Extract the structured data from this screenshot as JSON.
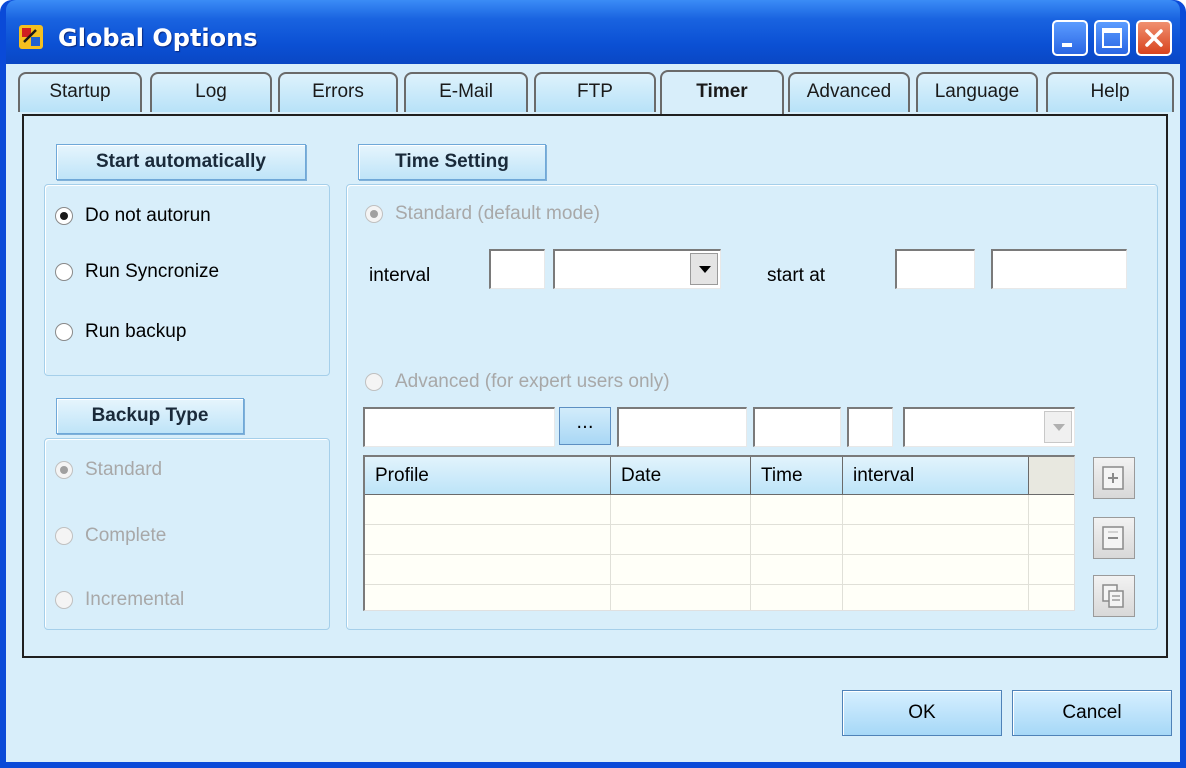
{
  "window": {
    "title": "Global Options"
  },
  "tabs": [
    {
      "label": "Startup"
    },
    {
      "label": "Log"
    },
    {
      "label": "Errors"
    },
    {
      "label": "E-Mail"
    },
    {
      "label": "FTP"
    },
    {
      "label": "Timer",
      "active": true
    },
    {
      "label": "Advanced"
    },
    {
      "label": "Language"
    },
    {
      "label": "Help"
    }
  ],
  "start_auto": {
    "heading": "Start automatically",
    "options": [
      {
        "label": "Do not autorun",
        "selected": true
      },
      {
        "label": "Run Syncronize",
        "selected": false
      },
      {
        "label": "Run backup",
        "selected": false
      }
    ]
  },
  "backup_type": {
    "heading": "Backup Type",
    "options": [
      {
        "label": "Standard",
        "selected": true,
        "disabled": true
      },
      {
        "label": "Complete",
        "selected": false,
        "disabled": true
      },
      {
        "label": "Incremental",
        "selected": false,
        "disabled": true
      }
    ]
  },
  "time_setting": {
    "heading": "Time Setting",
    "standard_label": "Standard (default mode)",
    "interval_label": "interval",
    "interval_value": "",
    "interval_unit": "",
    "start_at_label": "start at",
    "start_date": "",
    "start_time": "",
    "advanced_label": "Advanced (for expert users only)",
    "profile_value": "",
    "browse_label": "...",
    "date_value": "",
    "time_value": "",
    "interval_adv_value": "",
    "interval_adv_unit": "",
    "grid": {
      "columns": [
        "Profile",
        "Date",
        "Time",
        "interval"
      ],
      "rows": [
        [
          "",
          "",
          "",
          ""
        ],
        [
          "",
          "",
          "",
          ""
        ],
        [
          "",
          "",
          "",
          ""
        ],
        [
          "",
          "",
          "",
          ""
        ]
      ]
    }
  },
  "icons": {
    "add": "add-entry-icon",
    "remove": "remove-entry-icon",
    "copy": "copy-entry-icon"
  },
  "buttons": {
    "ok": "OK",
    "cancel": "Cancel"
  },
  "colors": {
    "titlebar": "#0b50d4",
    "client_bg": "#d8eefa",
    "disabled_text": "#a8a8a8"
  }
}
